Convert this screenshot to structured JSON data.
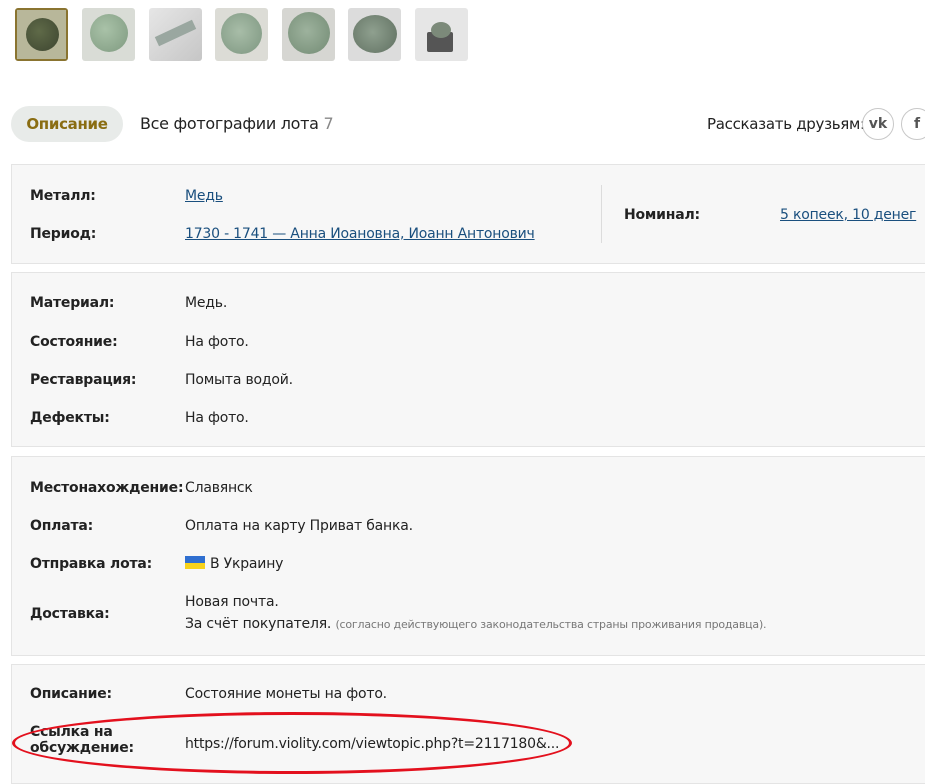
{
  "gallery": {
    "thumbnails": [
      {
        "name": "thumbnail-1",
        "active": true
      },
      {
        "name": "thumbnail-2",
        "active": false
      },
      {
        "name": "thumbnail-3",
        "active": false
      },
      {
        "name": "thumbnail-4",
        "active": false
      },
      {
        "name": "thumbnail-5",
        "active": false
      },
      {
        "name": "thumbnail-6",
        "active": false
      },
      {
        "name": "thumbnail-7",
        "active": false
      }
    ]
  },
  "tabs": {
    "description": "Описание",
    "all_photos": "Все фотографии лота",
    "photo_count": "7"
  },
  "share": {
    "label": "Рассказать друзьям:",
    "vk": "vk",
    "fb": "f"
  },
  "summary": {
    "metal_label": "Металл:",
    "metal_value": "Медь",
    "period_label": "Период:",
    "period_value": "1730 - 1741 — Анна Иоановна, Иоанн Антонович",
    "nominal_label": "Номинал:",
    "nominal_value": "5 копеек, 10 денег"
  },
  "condition": {
    "material_label": "Материал:",
    "material_value": "Медь.",
    "state_label": "Состояние:",
    "state_value": "На фото.",
    "restoration_label": "Реставрация:",
    "restoration_value": "Помыта водой.",
    "defects_label": "Дефекты:",
    "defects_value": "На фото."
  },
  "delivery": {
    "location_label": "Местонахождение:",
    "location_value": "Славянск",
    "payment_label": "Оплата:",
    "payment_value": "Оплата на карту Приват банка.",
    "shipping_label": "Отправка лота:",
    "shipping_value": "В Украину",
    "shipping_flag": "ukraine-flag",
    "delivery_label": "Доставка:",
    "delivery_line1": "Новая почта.",
    "delivery_line2": "За счёт покупателя.",
    "delivery_note": "(согласно действующего законодательства страны проживания продавца)."
  },
  "extra": {
    "description_label": "Описание:",
    "description_value": "Состояние монеты на фото.",
    "discussion_label_line1": "Ссылка на",
    "discussion_label_line2": "обсуждение:",
    "discussion_link": "https://forum.violity.com/viewtopic.php?t=2117180&..."
  },
  "colors": {
    "accent": "#8a6d12",
    "link": "#1a4f7e",
    "highlight": "#e3101d",
    "panel_bg": "#f7f7f7"
  }
}
